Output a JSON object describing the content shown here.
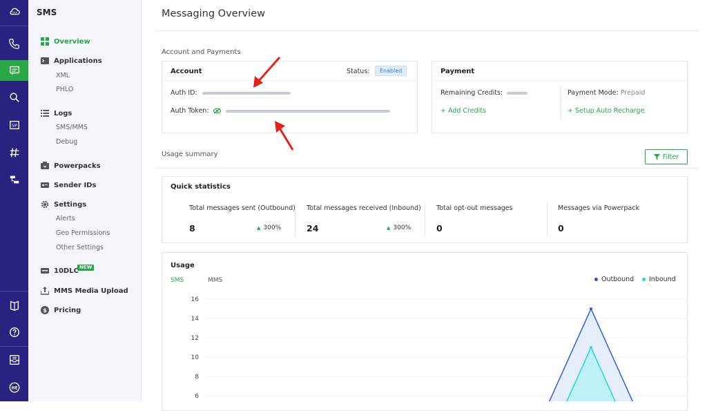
{
  "rail": {
    "icons": [
      "cloud-icon",
      "voice-call-icon",
      "sms-message-icon",
      "number-lookup-icon",
      "sip-trunking-icon",
      "hashtag-icon",
      "zentrunk-icon",
      "docs-book-icon",
      "help-icon",
      "inbox-icon",
      "account-icon"
    ],
    "active_color": "#29a845",
    "bg_color": "#2a2280"
  },
  "sidebar": {
    "title": "SMS",
    "items": [
      {
        "label": "Overview",
        "icon": "grid-icon"
      },
      {
        "label": "Applications",
        "icon": "app-icon"
      },
      {
        "label": "XML"
      },
      {
        "label": "PHLO"
      },
      {
        "label": "Logs",
        "icon": "list-icon"
      },
      {
        "label": "SMS/MMS"
      },
      {
        "label": "Debug"
      },
      {
        "label": "Powerpacks",
        "icon": "powerpack-icon"
      },
      {
        "label": "Sender IDs",
        "icon": "id-card-icon"
      },
      {
        "label": "Settings",
        "icon": "gear-icon"
      },
      {
        "label": "Alerts"
      },
      {
        "label": "Geo Permissions"
      },
      {
        "label": "Other Settings"
      },
      {
        "label": "10DLC",
        "icon": "tag-icon",
        "badge": "NEW"
      },
      {
        "label": "MMS Media Upload",
        "icon": "upload-icon"
      },
      {
        "label": "Pricing",
        "icon": "dollar-icon"
      }
    ]
  },
  "header": {
    "title": "Messaging Overview"
  },
  "account_payments": {
    "section_label": "Account and Payments",
    "account": {
      "title": "Account",
      "status_label": "Status:",
      "status_value": "Enabled",
      "auth_id_label": "Auth ID:",
      "auth_token_label": "Auth Token:"
    },
    "payment": {
      "title": "Payment",
      "remaining_credits_label": "Remaining Credits:",
      "payment_mode_label": "Payment Mode:",
      "payment_mode_value": "Prepaid",
      "add_credits": "+ Add Credits",
      "setup_auto_recharge": "+ Setup Auto Recharge"
    }
  },
  "usage_summary": {
    "section_label": "Usage summary",
    "filter_label": "Filter"
  },
  "quick_stats": {
    "title": "Quick statistics",
    "stats": [
      {
        "label": "Total messages sent (Outbound)",
        "value": "8",
        "change": "300%"
      },
      {
        "label": "Total messages received (Inbound)",
        "value": "24",
        "change": "300%"
      },
      {
        "label": "Total opt-out messages",
        "value": "0"
      },
      {
        "label": "Messages via Powerpack",
        "value": "0"
      }
    ]
  },
  "usage": {
    "title": "Usage",
    "tabs": [
      "SMS",
      "MMS"
    ],
    "active_tab": "SMS",
    "legend": [
      {
        "name": "Outbound",
        "color": "#2355d6"
      },
      {
        "name": "Inbound",
        "color": "#29d3e0"
      }
    ]
  },
  "chart_data": {
    "type": "area",
    "y_ticks": [
      "16",
      "14",
      "12",
      "10",
      "8",
      "6"
    ],
    "ylim": [
      6,
      16
    ],
    "series": [
      {
        "name": "Outbound",
        "peak": 15
      },
      {
        "name": "Inbound",
        "peak": 11
      }
    ]
  },
  "colors": {
    "accent_green": "#1faa42",
    "status_blue": "#3b7cc4"
  }
}
